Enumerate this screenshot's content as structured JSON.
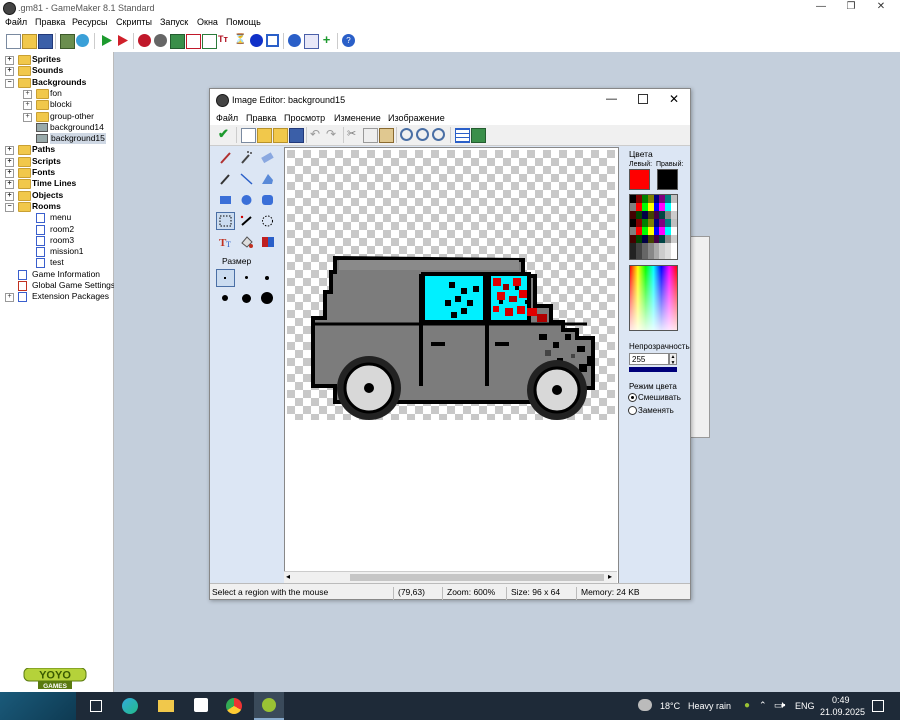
{
  "app": {
    "title": ".gm81 - GameMaker 8.1 Standard",
    "menu": [
      "Файл",
      "Правка",
      "Ресурсы",
      "Скрипты",
      "Запуск",
      "Окна",
      "Помощь"
    ],
    "window_controls": [
      "—",
      "❐",
      "✕"
    ]
  },
  "tree": {
    "items": [
      {
        "label": "Sprites",
        "level": 0,
        "bold": true,
        "kind": "folder",
        "expander": "+"
      },
      {
        "label": "Sounds",
        "level": 0,
        "bold": true,
        "kind": "folder",
        "expander": "+"
      },
      {
        "label": "Backgrounds",
        "level": 0,
        "bold": true,
        "kind": "folder",
        "expander": "−"
      },
      {
        "label": "fon",
        "level": 1,
        "bold": false,
        "kind": "folder",
        "expander": "+"
      },
      {
        "label": "blocki",
        "level": 1,
        "bold": false,
        "kind": "folder",
        "expander": "+"
      },
      {
        "label": "group-other",
        "level": 1,
        "bold": false,
        "kind": "folder",
        "expander": "+"
      },
      {
        "label": "background14",
        "level": 1,
        "bold": false,
        "kind": "bg",
        "expander": ""
      },
      {
        "label": "background15",
        "level": 1,
        "bold": false,
        "kind": "bg",
        "expander": "",
        "selected": true
      },
      {
        "label": "Paths",
        "level": 0,
        "bold": true,
        "kind": "folder",
        "expander": "+"
      },
      {
        "label": "Scripts",
        "level": 0,
        "bold": true,
        "kind": "folder",
        "expander": "+"
      },
      {
        "label": "Fonts",
        "level": 0,
        "bold": true,
        "kind": "folder",
        "expander": "+"
      },
      {
        "label": "Time Lines",
        "level": 0,
        "bold": true,
        "kind": "folder",
        "expander": "+"
      },
      {
        "label": "Objects",
        "level": 0,
        "bold": true,
        "kind": "folder",
        "expander": "+"
      },
      {
        "label": "Rooms",
        "level": 0,
        "bold": true,
        "kind": "folder",
        "expander": "−"
      },
      {
        "label": "menu",
        "level": 1,
        "bold": false,
        "kind": "room",
        "expander": ""
      },
      {
        "label": "room2",
        "level": 1,
        "bold": false,
        "kind": "room",
        "expander": ""
      },
      {
        "label": "room3",
        "level": 1,
        "bold": false,
        "kind": "room",
        "expander": ""
      },
      {
        "label": "mission1",
        "level": 1,
        "bold": false,
        "kind": "room",
        "expander": ""
      },
      {
        "label": "test",
        "level": 1,
        "bold": false,
        "kind": "room",
        "expander": ""
      },
      {
        "label": "Game Information",
        "level": 0,
        "bold": false,
        "kind": "info",
        "expander": ""
      },
      {
        "label": "Global Game Settings",
        "level": 0,
        "bold": false,
        "kind": "settings",
        "expander": ""
      },
      {
        "label": "Extension Packages",
        "level": 0,
        "bold": false,
        "kind": "ext",
        "expander": "+"
      }
    ]
  },
  "logo": {
    "line1": "YOYO",
    "line2": "GAMES"
  },
  "editor": {
    "title": "Image Editor: background15",
    "menu": [
      "Файл",
      "Правка",
      "Просмотр",
      "Изменение",
      "Изображение"
    ],
    "size_label": "Размер",
    "colors": {
      "heading": "Цвета",
      "left_label": "Левый:",
      "right_label": "Правый:",
      "left_color": "#ff0000",
      "right_color": "#000000",
      "opacity_label": "Непрозрачность",
      "opacity_value": "255",
      "mode_label": "Режим цвета",
      "mode_blend": "Смешивать",
      "mode_replace": "Заменять"
    },
    "status": {
      "hint": "Select a region with the mouse",
      "coords": "(79,63)",
      "zoom": "Zoom: 600%",
      "size": "Size: 96 x 64",
      "memory": "Memory: 24 KB"
    }
  },
  "taskbar": {
    "weather_temp": "18°C",
    "weather_text": "Heavy rain",
    "language": "ENG",
    "time": "0:49",
    "date": "21.09.2025"
  }
}
